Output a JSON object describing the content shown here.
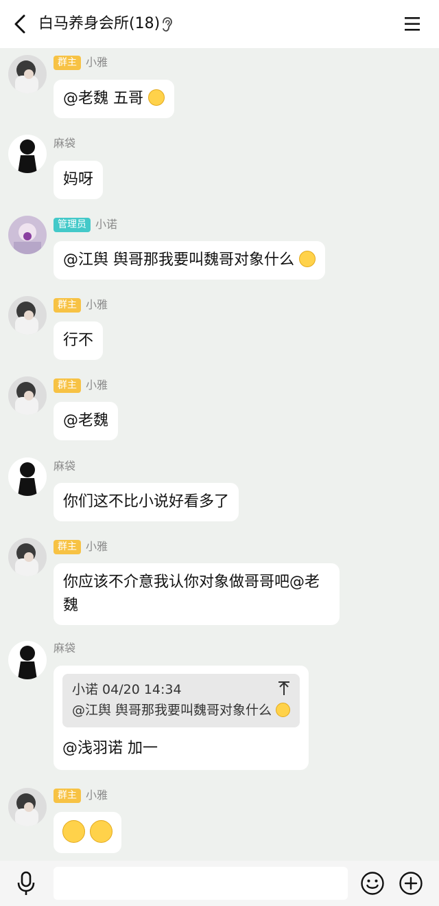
{
  "header": {
    "title": "白马养身会所(18)",
    "back_icon": "chevron-left-icon",
    "listen_icon": "ear-icon",
    "menu_icon": "menu-icon"
  },
  "messages": [
    {
      "sender": "小雅",
      "badge": "群主",
      "text": "@老魏 五哥",
      "emoji": "thinking-emoji"
    },
    {
      "sender": "麻袋",
      "text": "妈呀"
    },
    {
      "sender": "小诺",
      "badge": "管理员",
      "text": "@江舆 舆哥那我要叫魏哥对象什么",
      "emoji": "flushed-emoji"
    },
    {
      "sender": "小雅",
      "badge": "群主",
      "text": "行不"
    },
    {
      "sender": "小雅",
      "badge": "群主",
      "text": "@老魏"
    },
    {
      "sender": "麻袋",
      "text": "你们这不比小说好看多了"
    },
    {
      "sender": "小雅",
      "badge": "群主",
      "text": "你应该不介意我认你对象做哥哥吧@老魏"
    },
    {
      "sender": "麻袋",
      "quote": {
        "meta": "小诺 04/20 14:34",
        "text": "@江舆 舆哥那我要叫魏哥对象什么",
        "emoji": "flushed-emoji"
      },
      "text": "@浅羽诺 加一"
    },
    {
      "sender": "小雅",
      "badge": "群主",
      "emojis": [
        "smirk-emoji",
        "smirk-emoji"
      ]
    }
  ],
  "input": {
    "value": "",
    "placeholder": ""
  },
  "bottom_icons": {
    "mic": "microphone-icon",
    "emoji": "smiley-icon",
    "plus": "plus-circle-icon"
  },
  "colors": {
    "owner_badge": "#f7c244",
    "admin_badge": "#43c9c9",
    "background": "#eef1ee"
  }
}
